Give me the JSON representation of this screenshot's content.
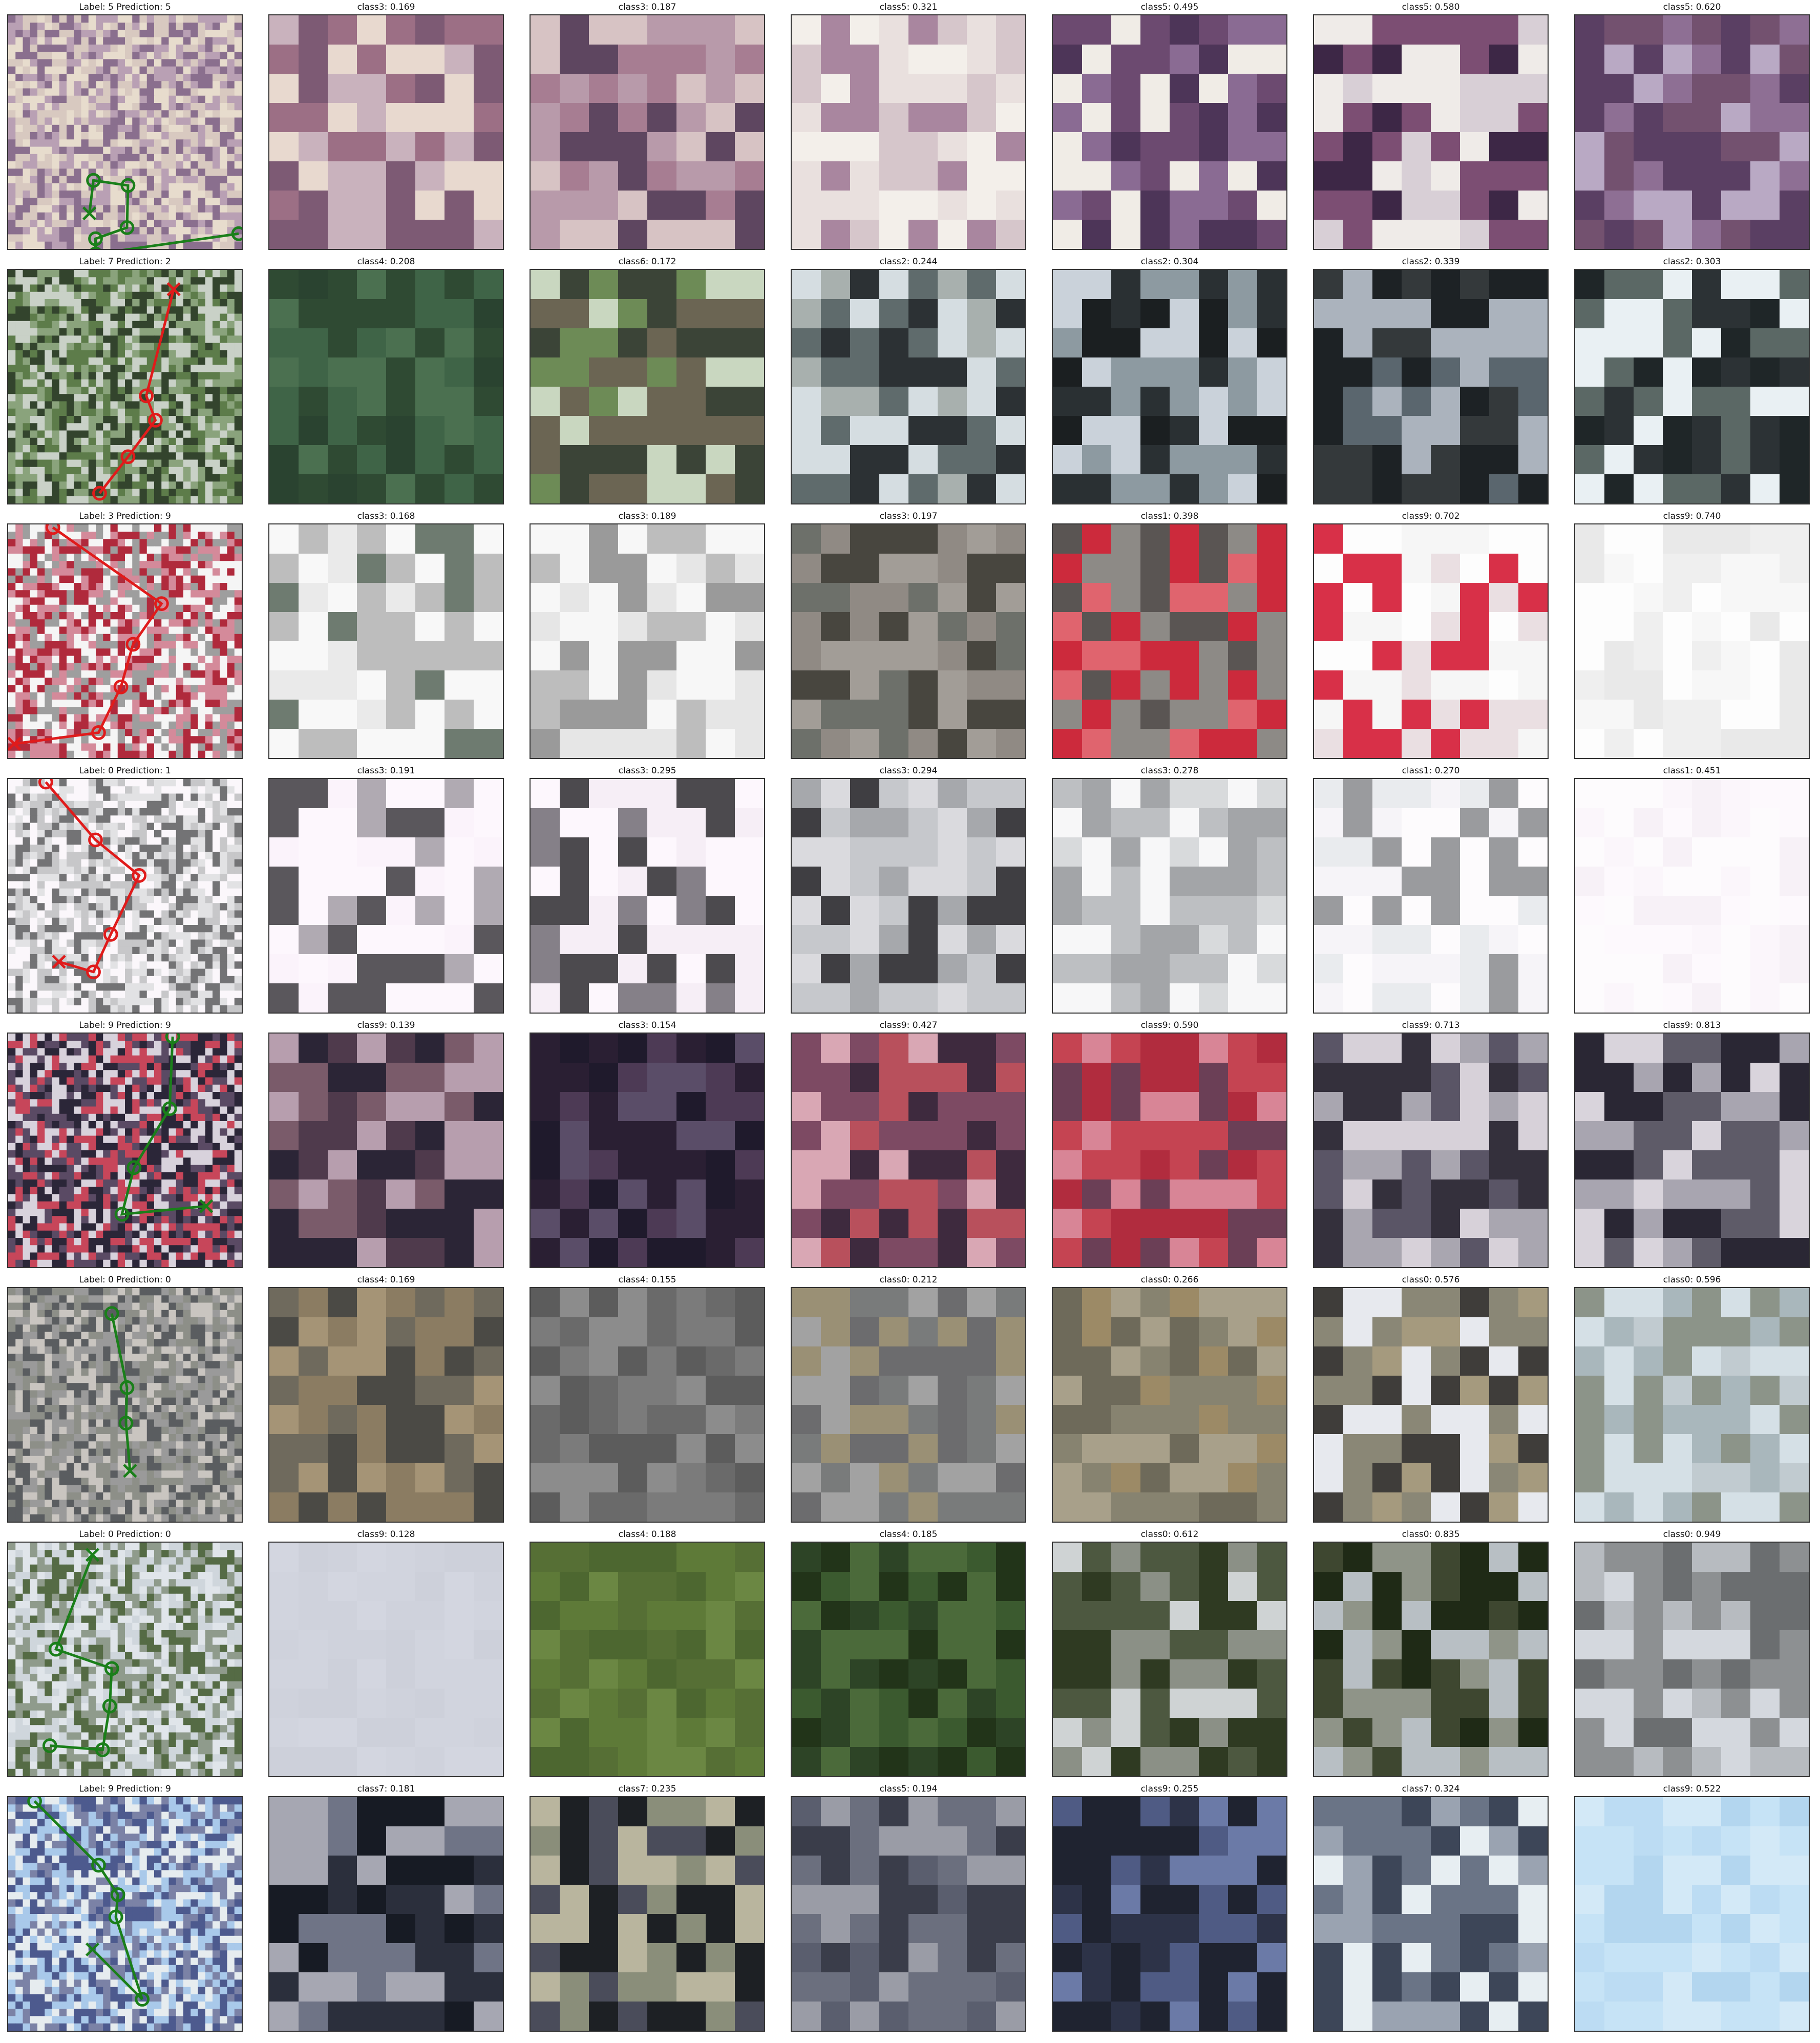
{
  "figure": {
    "rows": [
      {
        "orig_title": "Label: 5 Prediction: 5",
        "path_color": "#1a7f1a",
        "patch_titles": [
          "class3: 0.169",
          "class3: 0.187",
          "class5: 0.321",
          "class5: 0.495",
          "class5: 0.580",
          "class5: 0.620"
        ]
      },
      {
        "orig_title": "Label: 7 Prediction: 2",
        "path_color": "#e01b1b",
        "patch_titles": [
          "class4: 0.208",
          "class6: 0.172",
          "class2: 0.244",
          "class2: 0.304",
          "class2: 0.339",
          "class2: 0.303"
        ]
      },
      {
        "orig_title": "Label: 3 Prediction: 9",
        "path_color": "#e01b1b",
        "patch_titles": [
          "class3: 0.168",
          "class3: 0.189",
          "class3: 0.197",
          "class1: 0.398",
          "class9: 0.702",
          "class9: 0.740"
        ]
      },
      {
        "orig_title": "Label: 0 Prediction: 1",
        "path_color": "#e01b1b",
        "patch_titles": [
          "class3: 0.191",
          "class3: 0.295",
          "class3: 0.294",
          "class3: 0.278",
          "class1: 0.270",
          "class1: 0.451"
        ]
      },
      {
        "orig_title": "Label: 9 Prediction: 9",
        "path_color": "#1a7f1a",
        "patch_titles": [
          "class9: 0.139",
          "class3: 0.154",
          "class9: 0.427",
          "class9: 0.590",
          "class9: 0.713",
          "class9: 0.813"
        ]
      },
      {
        "orig_title": "Label: 0 Prediction: 0",
        "path_color": "#1a7f1a",
        "patch_titles": [
          "class4: 0.169",
          "class4: 0.155",
          "class0: 0.212",
          "class0: 0.266",
          "class0: 0.576",
          "class0: 0.596"
        ]
      },
      {
        "orig_title": "Label: 0 Prediction: 0",
        "path_color": "#1a7f1a",
        "patch_titles": [
          "class9: 0.128",
          "class4: 0.188",
          "class4: 0.185",
          "class0: 0.612",
          "class0: 0.835",
          "class0: 0.949"
        ]
      },
      {
        "orig_title": "Label: 9 Prediction: 9",
        "path_color": "#1a7f1a",
        "patch_titles": [
          "class7: 0.181",
          "class7: 0.235",
          "class5: 0.194",
          "class9: 0.255",
          "class7: 0.324",
          "class9: 0.522"
        ]
      }
    ]
  }
}
